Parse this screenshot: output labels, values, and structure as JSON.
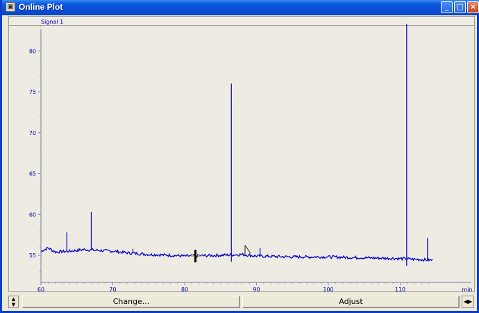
{
  "window": {
    "title": "Online Plot",
    "icons": [
      "system-menu-icon",
      "minimize-icon",
      "maximize-icon",
      "close-icon"
    ]
  },
  "plot": {
    "signal_label": "Signal 1",
    "colors": {
      "trace": "#0000C8",
      "axis": "#0000A0",
      "background": "#EEEBE3"
    }
  },
  "chart_data": {
    "type": "line",
    "title": "",
    "xlabel": "min",
    "ylabel": "",
    "xlim": [
      60,
      114.5
    ],
    "ylim": [
      51.5,
      84
    ],
    "x_ticks": [
      "60",
      "70",
      "80",
      "90",
      "100",
      "110"
    ],
    "y_ticks": [
      "55",
      "60",
      "65",
      "70",
      "75",
      "80"
    ],
    "grid": false,
    "series": [
      {
        "baseline": [
          [
            60,
            55.5
          ],
          [
            61,
            55.9
          ],
          [
            62,
            55.4
          ],
          [
            64,
            55.5
          ],
          [
            66,
            55.7
          ],
          [
            68,
            55.6
          ],
          [
            70,
            55.5
          ],
          [
            72,
            55.3
          ],
          [
            75,
            55.1
          ],
          [
            78,
            55.0
          ],
          [
            80,
            54.9
          ],
          [
            85,
            55.0
          ],
          [
            88,
            55.1
          ],
          [
            90,
            54.9
          ],
          [
            95,
            54.8
          ],
          [
            100,
            54.8
          ],
          [
            105,
            54.7
          ],
          [
            110,
            54.6
          ],
          [
            114.5,
            54.4
          ]
        ],
        "peaks": [
          [
            63.6,
            57.8
          ],
          [
            67.0,
            60.3
          ],
          [
            72.8,
            55.8
          ],
          [
            86.5,
            76.0
          ],
          [
            90.5,
            55.9
          ],
          [
            110.9,
            83.3
          ],
          [
            113.8,
            57.1
          ]
        ]
      }
    ]
  },
  "bottom": {
    "change_label": "Change...",
    "adjust_label": "Adjust"
  }
}
